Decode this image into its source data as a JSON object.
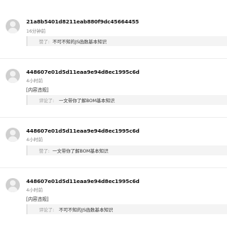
{
  "feed": {
    "items": [
      {
        "user": "21a8b5401d8211eab880f9dc45664455",
        "time": "16分钟前",
        "note": "",
        "action": "赞了:",
        "ref_title": "不可不知的JS函数基本知识"
      },
      {
        "user": "448607e01d5d11eaa9e94d8ec1995c6d",
        "time": "4小时前",
        "note": "[内容违规]",
        "action": "评论了:",
        "ref_title": "一文带你了解BOM基本知识"
      },
      {
        "user": "448607e01d5d11eaa9e94d8ec1995c6d",
        "time": "4小时前",
        "note": "",
        "action": "赞了:",
        "ref_title": "一文带你了解BOM基本知识"
      },
      {
        "user": "448607e01d5d11eaa9e94d8ec1995c6d",
        "time": "4小时前",
        "note": "[内容违规]",
        "action": "评论了:",
        "ref_title": "不可不知的JS函数基本知识"
      }
    ]
  }
}
